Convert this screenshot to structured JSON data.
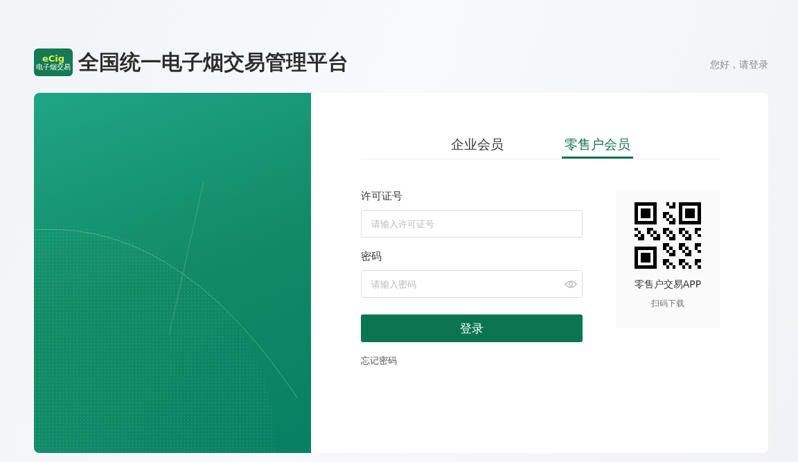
{
  "header": {
    "logo": {
      "wordmark": "eCig",
      "caption": "电子烟交易"
    },
    "title": "全国统一电子烟交易管理平台",
    "greeting": "您好，请登录"
  },
  "tabs": [
    {
      "label": "企业会员",
      "selected": false
    },
    {
      "label": "零售户会员",
      "selected": true
    }
  ],
  "form": {
    "fields": [
      {
        "kind": "text",
        "label": "许可证号",
        "placeholder": "请输入许可证号"
      },
      {
        "kind": "password",
        "label": "密码",
        "placeholder": "请输入密码"
      }
    ],
    "submit": "登录",
    "forgot": "忘记密码"
  },
  "qr": {
    "title": "零售户交易APP",
    "hint": "扫码下载"
  }
}
